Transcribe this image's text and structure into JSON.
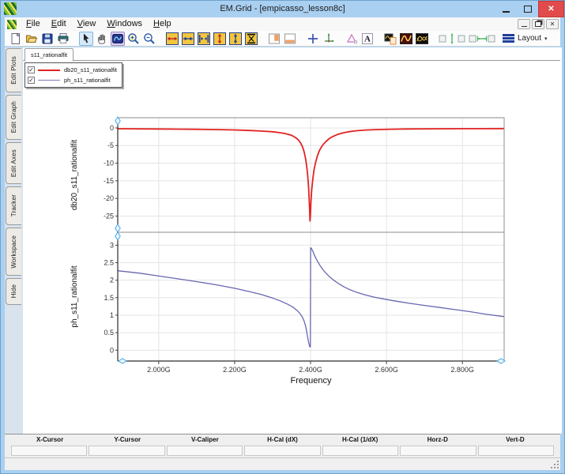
{
  "window": {
    "title": "EM.Grid - [empicasso_lesson8c]",
    "controls": {
      "minimize": "minimize",
      "maximize": "maximize",
      "close": "close"
    }
  },
  "menu": {
    "items": [
      "File",
      "Edit",
      "View",
      "Windows",
      "Help"
    ]
  },
  "toolbar": {
    "layout_label": "Layout",
    "icons": [
      {
        "name": "new-document"
      },
      {
        "name": "open-file"
      },
      {
        "name": "save"
      },
      {
        "name": "print"
      },
      {
        "name": "select-arrow",
        "selected": "blue"
      },
      {
        "name": "pan-hand"
      },
      {
        "name": "zoom-window",
        "selected": "purple"
      },
      {
        "name": "zoom-in"
      },
      {
        "name": "zoom-out"
      },
      {
        "name": "expand-x"
      },
      {
        "name": "shrink-x"
      },
      {
        "name": "fit-x"
      },
      {
        "name": "expand-y"
      },
      {
        "name": "shrink-y"
      },
      {
        "name": "fit-y"
      },
      {
        "name": "page-column"
      },
      {
        "name": "page-row"
      },
      {
        "name": "add-marker"
      },
      {
        "name": "axes-tool"
      },
      {
        "name": "delta-marker"
      },
      {
        "name": "text-label"
      },
      {
        "name": "copy-plot"
      },
      {
        "name": "plot-style-dark"
      },
      {
        "name": "plot-style-black"
      },
      {
        "name": "align-vertical"
      },
      {
        "name": "align-horizontal"
      }
    ]
  },
  "sidebar": {
    "tabs": [
      "Edit Plots",
      "Edit Graph",
      "Edit Axes",
      "Tracker",
      "Workspace",
      "Hide"
    ]
  },
  "document": {
    "tab": "s11_rationalfit"
  },
  "legend": {
    "items": [
      {
        "label": "db20_s11_rationalfit",
        "color": "#e32222",
        "checked": true
      },
      {
        "label": "ph_s11_rationalfit",
        "color": "#7d7dba",
        "checked": true
      }
    ]
  },
  "chart_data": {
    "type": "line",
    "xlabel": "Frequency",
    "x_range": [
      1.892,
      2.91
    ],
    "x_ticks": [
      {
        "value": 2.0,
        "label": "2.000G"
      },
      {
        "value": 2.2,
        "label": "2.200G"
      },
      {
        "value": 2.4,
        "label": "2.400G"
      },
      {
        "value": 2.6,
        "label": "2.600G"
      },
      {
        "value": 2.8,
        "label": "2.800G"
      }
    ],
    "subplots": [
      {
        "ylabel": "db20_s11_rationalfit",
        "y_range": [
          2.9,
          -29.6
        ],
        "y_ticks": [
          0,
          -5,
          -10,
          -15,
          -20,
          -25
        ],
        "series": {
          "name": "db20_s11_rationalfit",
          "color": "#e32222",
          "points": [
            [
              1.892,
              -0.22
            ],
            [
              1.95,
              -0.26
            ],
            [
              2.0,
              -0.3
            ],
            [
              2.05,
              -0.34
            ],
            [
              2.1,
              -0.4
            ],
            [
              2.15,
              -0.47
            ],
            [
              2.2,
              -0.58
            ],
            [
              2.24,
              -0.72
            ],
            [
              2.27,
              -0.88
            ],
            [
              2.3,
              -1.1
            ],
            [
              2.32,
              -1.35
            ],
            [
              2.335,
              -1.65
            ],
            [
              2.35,
              -2.1
            ],
            [
              2.36,
              -2.7
            ],
            [
              2.368,
              -3.4
            ],
            [
              2.374,
              -4.3
            ],
            [
              2.379,
              -5.4
            ],
            [
              2.383,
              -6.8
            ],
            [
              2.387,
              -8.8
            ],
            [
              2.39,
              -11.0
            ],
            [
              2.3925,
              -13.5
            ],
            [
              2.3945,
              -16.5
            ],
            [
              2.396,
              -19.5
            ],
            [
              2.3975,
              -23.0
            ],
            [
              2.3985,
              -26.4
            ],
            [
              2.3995,
              -25.0
            ],
            [
              2.401,
              -21.0
            ],
            [
              2.403,
              -17.5
            ],
            [
              2.406,
              -14.5
            ],
            [
              2.409,
              -12.0
            ],
            [
              2.413,
              -9.8
            ],
            [
              2.418,
              -7.9
            ],
            [
              2.424,
              -6.3
            ],
            [
              2.431,
              -5.0
            ],
            [
              2.439,
              -4.0
            ],
            [
              2.448,
              -3.1
            ],
            [
              2.458,
              -2.45
            ],
            [
              2.47,
              -1.9
            ],
            [
              2.484,
              -1.45
            ],
            [
              2.5,
              -1.1
            ],
            [
              2.52,
              -0.8
            ],
            [
              2.545,
              -0.6
            ],
            [
              2.575,
              -0.46
            ],
            [
              2.61,
              -0.37
            ],
            [
              2.65,
              -0.31
            ],
            [
              2.7,
              -0.27
            ],
            [
              2.75,
              -0.24
            ],
            [
              2.8,
              -0.22
            ],
            [
              2.85,
              -0.21
            ],
            [
              2.908,
              -0.2
            ]
          ]
        }
      },
      {
        "ylabel": "ph_s11_rationalfit",
        "y_range": [
          3.37,
          -0.31
        ],
        "y_ticks": [
          3,
          2.5,
          2,
          1.5,
          1,
          0.5,
          0
        ],
        "series": {
          "name": "ph_s11_rationalfit",
          "color": "#6767af",
          "points": [
            [
              1.892,
              2.27
            ],
            [
              1.95,
              2.2
            ],
            [
              2.0,
              2.12
            ],
            [
              2.05,
              2.04
            ],
            [
              2.1,
              1.96
            ],
            [
              2.15,
              1.87
            ],
            [
              2.2,
              1.77
            ],
            [
              2.24,
              1.67
            ],
            [
              2.27,
              1.59
            ],
            [
              2.3,
              1.49
            ],
            [
              2.32,
              1.41
            ],
            [
              2.34,
              1.31
            ],
            [
              2.355,
              1.22
            ],
            [
              2.365,
              1.13
            ],
            [
              2.372,
              1.05
            ],
            [
              2.378,
              0.95
            ],
            [
              2.383,
              0.83
            ],
            [
              2.387,
              0.68
            ],
            [
              2.39,
              0.52
            ],
            [
              2.3925,
              0.36
            ],
            [
              2.395,
              0.22
            ],
            [
              2.397,
              0.13
            ],
            [
              2.3985,
              0.09
            ],
            [
              2.3995,
              0.1
            ],
            [
              2.4002,
              2.93
            ],
            [
              2.402,
              2.91
            ],
            [
              2.404,
              2.87
            ],
            [
              2.407,
              2.8
            ],
            [
              2.41,
              2.72
            ],
            [
              2.414,
              2.63
            ],
            [
              2.419,
              2.53
            ],
            [
              2.425,
              2.42
            ],
            [
              2.432,
              2.31
            ],
            [
              2.44,
              2.21
            ],
            [
              2.45,
              2.1
            ],
            [
              2.461,
              2.0
            ],
            [
              2.474,
              1.9
            ],
            [
              2.488,
              1.81
            ],
            [
              2.503,
              1.73
            ],
            [
              2.52,
              1.66
            ],
            [
              2.54,
              1.59
            ],
            [
              2.565,
              1.52
            ],
            [
              2.59,
              1.47
            ],
            [
              2.62,
              1.41
            ],
            [
              2.66,
              1.34
            ],
            [
              2.7,
              1.28
            ],
            [
              2.74,
              1.22
            ],
            [
              2.78,
              1.16
            ],
            [
              2.82,
              1.1
            ],
            [
              2.86,
              1.03
            ],
            [
              2.908,
              0.96
            ]
          ]
        }
      }
    ]
  },
  "cursor_panel": {
    "headers": [
      "X-Cursor",
      "Y-Cursor",
      "V-Caliper",
      "H-Cal (dX)",
      "H-Cal (1/dX)",
      "Horz-D",
      "Vert-D"
    ],
    "values": [
      "",
      "",
      "",
      "",
      "",
      "",
      ""
    ]
  },
  "colors": {
    "titlebar": "#a9cff1",
    "close_button": "#e14b4b",
    "curve_db20": "#e32222",
    "curve_phase": "#6767af",
    "handle": "#45a6e8"
  }
}
